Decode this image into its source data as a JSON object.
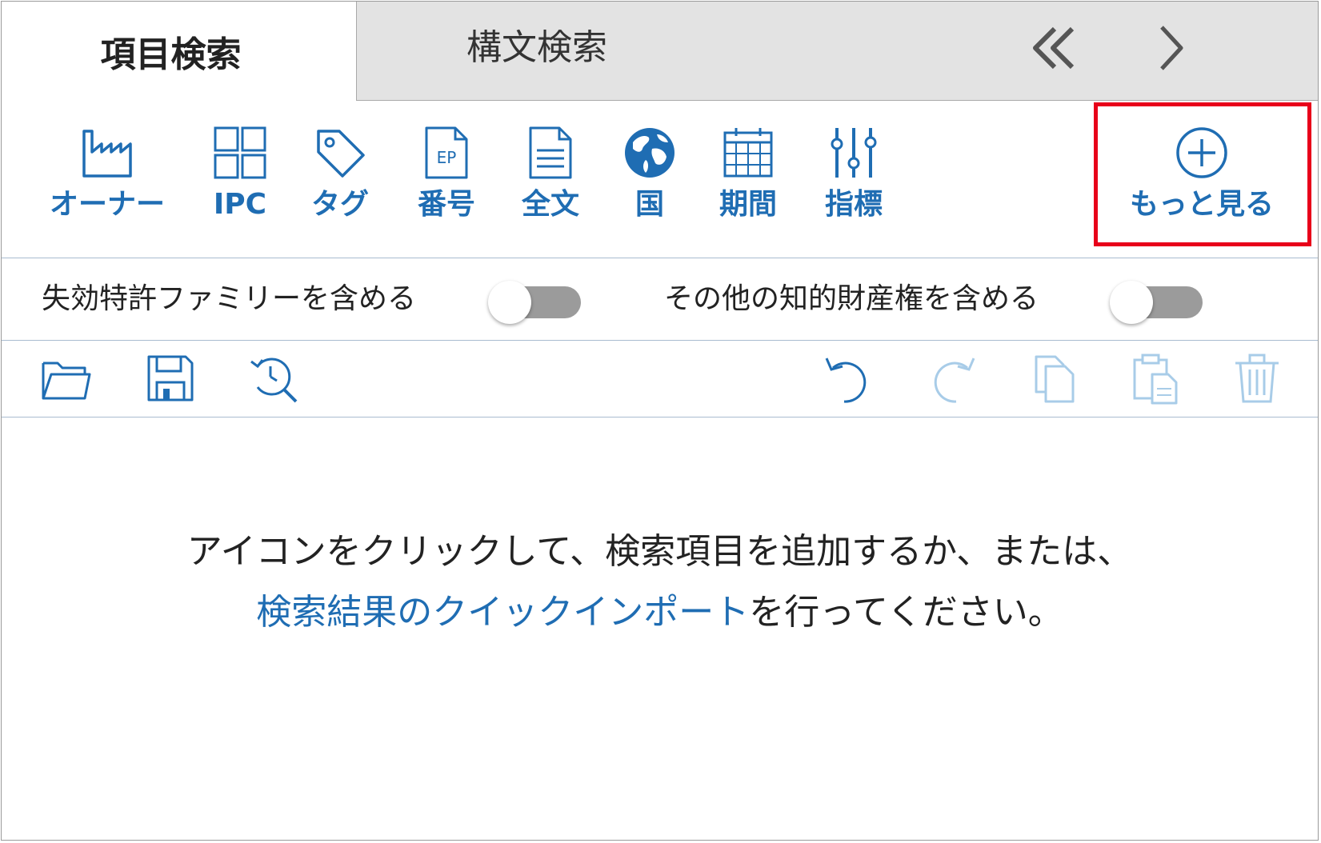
{
  "tabs": {
    "active_label": "項目検索",
    "inactive_label": "構文検索"
  },
  "toolbar": {
    "owner": "オーナー",
    "ipc": "IPC",
    "tag": "タグ",
    "number": "番号",
    "number_icon_text": "EP",
    "fulltext": "全文",
    "country": "国",
    "period": "期間",
    "indicator": "指標",
    "more": "もっと見る"
  },
  "toggles": {
    "expired_family": "失効特許ファミリーを含める",
    "other_ip": "その他の知的財産権を含める",
    "expired_family_on": false,
    "other_ip_on": false
  },
  "message": {
    "line1": "アイコンをクリックして、検索項目を追加するか、または、",
    "link": "検索結果のクイックインポート",
    "line2_suffix": "を行ってください。"
  },
  "colors": {
    "accent": "#1f6db3",
    "highlight": "#e8001a",
    "disabled": "#a8cce8",
    "tab_inactive_bg": "#e3e3e3"
  }
}
